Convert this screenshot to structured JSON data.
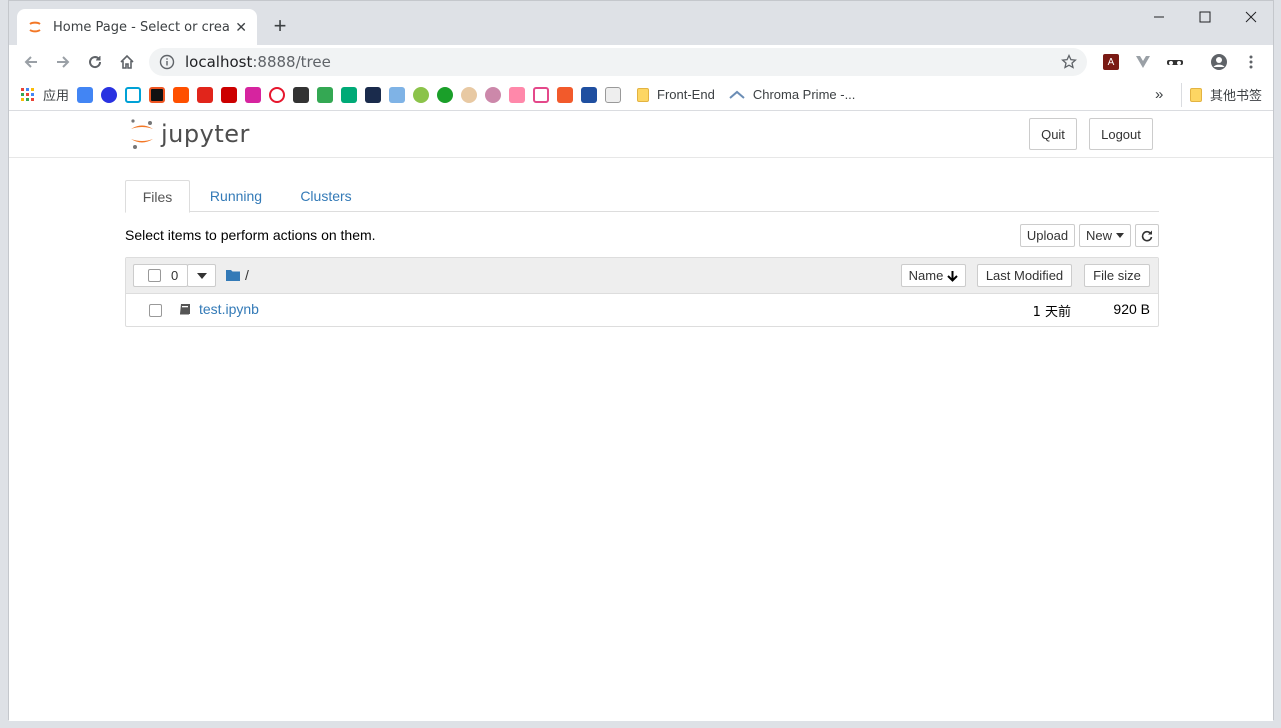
{
  "browser": {
    "tab_title": "Home Page - Select or create",
    "url_host": "localhost",
    "url_path": ":8888/tree",
    "bookmarks": {
      "apps_label": "应用",
      "front_end": "Front-End",
      "chroma": "Chroma Prime -...",
      "other": "其他书签",
      "overflow": "»"
    }
  },
  "jupyter": {
    "logo_text": "jupyter",
    "quit": "Quit",
    "logout": "Logout",
    "tabs": [
      "Files",
      "Running",
      "Clusters"
    ],
    "hint": "Select items to perform actions on them.",
    "upload": "Upload",
    "new": "New",
    "selected_count": "0",
    "path": "/",
    "sort_name": "Name",
    "sort_modified": "Last Modified",
    "sort_size": "File size",
    "files": [
      {
        "name": "test.ipynb",
        "modified": "1 天前",
        "size": "920 B"
      }
    ]
  },
  "colors": {
    "link": "#337ab7",
    "jupyter_orange": "#f37726"
  }
}
